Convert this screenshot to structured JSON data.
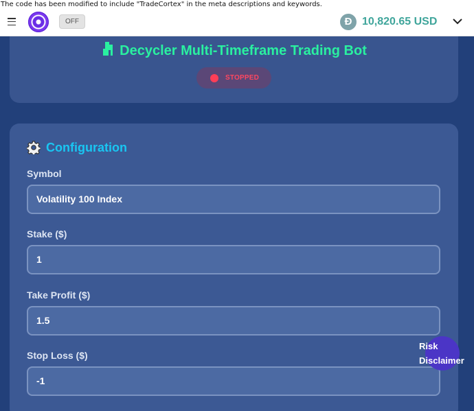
{
  "notice": "The code has been modified to include \"TradeCortex\" in the meta descriptions and keywords.",
  "topbar": {
    "toggle_label": "OFF",
    "balance": "10,820.65 USD",
    "balance_icon_glyph": "Ð"
  },
  "bot": {
    "title": "Decycler Multi-Timeframe Trading Bot",
    "status": "STOPPED"
  },
  "config": {
    "title": "Configuration",
    "fields": [
      {
        "label": "Symbol",
        "value": "Volatility 100 Index"
      },
      {
        "label": "Stake ($)",
        "value": "1"
      },
      {
        "label": "Take Profit ($)",
        "value": "1.5"
      },
      {
        "label": "Stop Loss ($)",
        "value": "-1"
      }
    ]
  },
  "risk_button": {
    "line1": "Risk",
    "line2": "Disclaimer"
  },
  "colors": {
    "accent_green": "#2af0a0",
    "accent_cyan": "#19c6f2",
    "status_red": "#ff3e57",
    "balance_teal": "#3fa59b"
  },
  "icons": [
    "menu-icon",
    "app-logo-icon",
    "currency-icon",
    "chevron-down-icon",
    "robot-icon",
    "status-dot-icon",
    "gear-icon"
  ]
}
